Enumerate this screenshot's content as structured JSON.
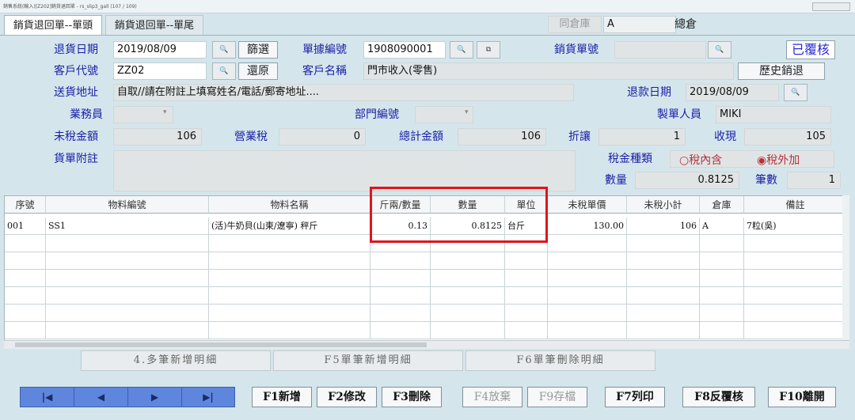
{
  "window": {
    "title": "銷售系統(輸入)[Z202]銷貨退回單 - rs_slip3_gall   (107 / 109)"
  },
  "tabs": [
    "銷貨退回單--單頭",
    "銷貨退回單--單尾"
  ],
  "warehouse": {
    "label": "同倉庫",
    "code": "A",
    "name": "總倉"
  },
  "form": {
    "return_date_label": "退貨日期",
    "return_date": "2019/08/09",
    "filter_btn": "篩選",
    "doc_no_label": "單據編號",
    "doc_no": "1908090001",
    "sales_no_label": "銷貨單號",
    "sales_no": "",
    "status": "已覆核",
    "customer_code_label": "客戶代號",
    "customer_code": "ZZ02",
    "restore_btn": "還原",
    "customer_name_label": "客戶名稱",
    "customer_name": "門市收入(零售)",
    "history_btn": "歷史銷退",
    "address_label": "送貨地址",
    "address": "自取//請在附註上填寫姓名/電話/郵寄地址....",
    "refund_date_label": "退款日期",
    "refund_date": "2019/08/09",
    "salesperson_label": "業務員",
    "salesperson": "",
    "dept_label": "部門編號",
    "dept": "",
    "creator_label": "製單人員",
    "creator": "MIKI",
    "pretax_label": "未稅金額",
    "pretax": "106",
    "tax_label": "營業稅",
    "tax": "0",
    "total_label": "總計金額",
    "total": "106",
    "discount_label": "折讓",
    "discount": "1",
    "received_label": "收現",
    "received": "105",
    "note_label": "貨單附註",
    "note": "",
    "tax_type_label": "稅金種類",
    "tax_opt1": "○稅內含",
    "tax_opt2": "◉稅外加",
    "qty_label": "數量",
    "qty": "0.8125",
    "count_label": "筆數",
    "count": "1"
  },
  "grid": {
    "headers": [
      "序號",
      "物料編號",
      "物料名稱",
      "斤兩/數量",
      "數量",
      "單位",
      "未稅單價",
      "未稅小計",
      "倉庫",
      "備註"
    ],
    "rows": [
      [
        "001",
        "SS1",
        "(活)牛奶貝(山東/遼寧) 秤斤",
        "0.13",
        "0.8125",
        "台斤",
        "130.00",
        "106",
        "A",
        "7粒(吳)"
      ]
    ]
  },
  "group_buttons": [
    "4.多筆新增明細",
    "F5單筆新增明細",
    "F6單筆刪除明細"
  ],
  "nav_buttons": [
    "|◀",
    "◀",
    "▶",
    "▶|"
  ],
  "function_buttons": [
    "F1新增",
    "F2修改",
    "F3刪除",
    "F4放棄",
    "F9存檔",
    "F7列印",
    "F8反覆核",
    "F10離開"
  ]
}
